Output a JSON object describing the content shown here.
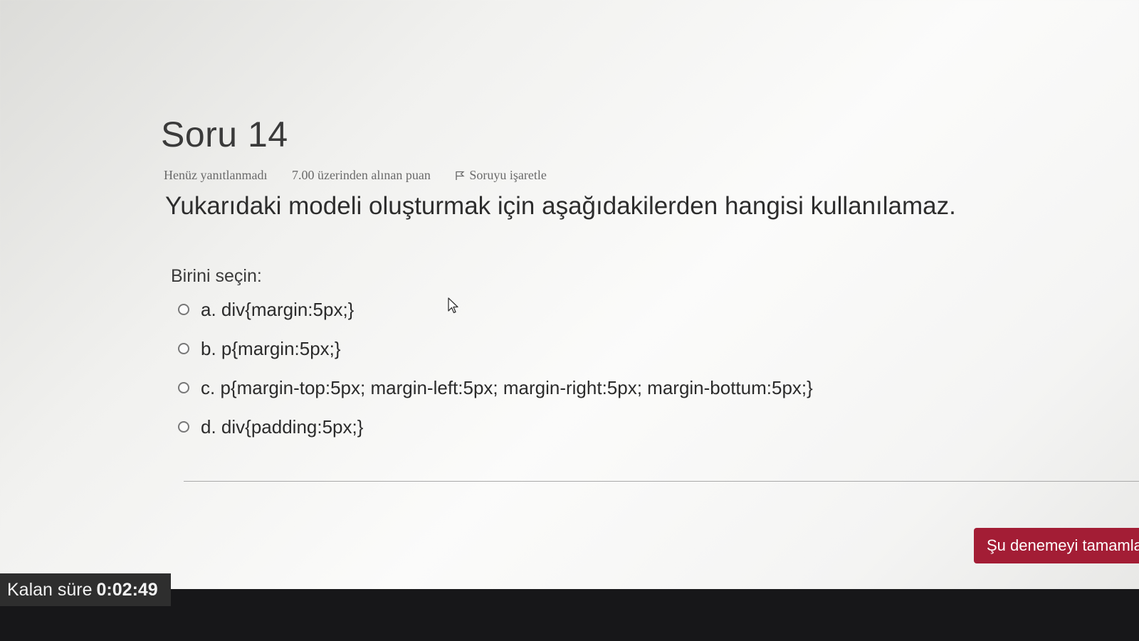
{
  "question": {
    "title": "Soru 14",
    "status": "Henüz yanıtlanmadı",
    "mark": "7.00 üzerinden alınan puan",
    "flag_label": "Soruyu işaretle",
    "text": "Yukarıdaki modeli oluşturmak için aşağıdakilerden hangisi kullanılamaz.",
    "prompt": "Birini seçin:",
    "answers": [
      {
        "label": "a. div{margin:5px;}"
      },
      {
        "label": "b. p{margin:5px;}"
      },
      {
        "label": "c. p{margin-top:5px; margin-left:5px; margin-right:5px; margin-bottum:5px;}"
      },
      {
        "label": "d. div{padding:5px;}"
      }
    ]
  },
  "finish_button": {
    "label": "Şu denemeyi tamamla"
  },
  "timer": {
    "label": "Kalan süre",
    "value": "0:02:49"
  },
  "colors": {
    "finish_button": "#a31d35",
    "timer_background": "#2e2e2e",
    "bottom_bar": "#171719"
  },
  "icons": {
    "flag": "flag-icon",
    "radio": "radio-icon",
    "cursor": "cursor-icon"
  }
}
